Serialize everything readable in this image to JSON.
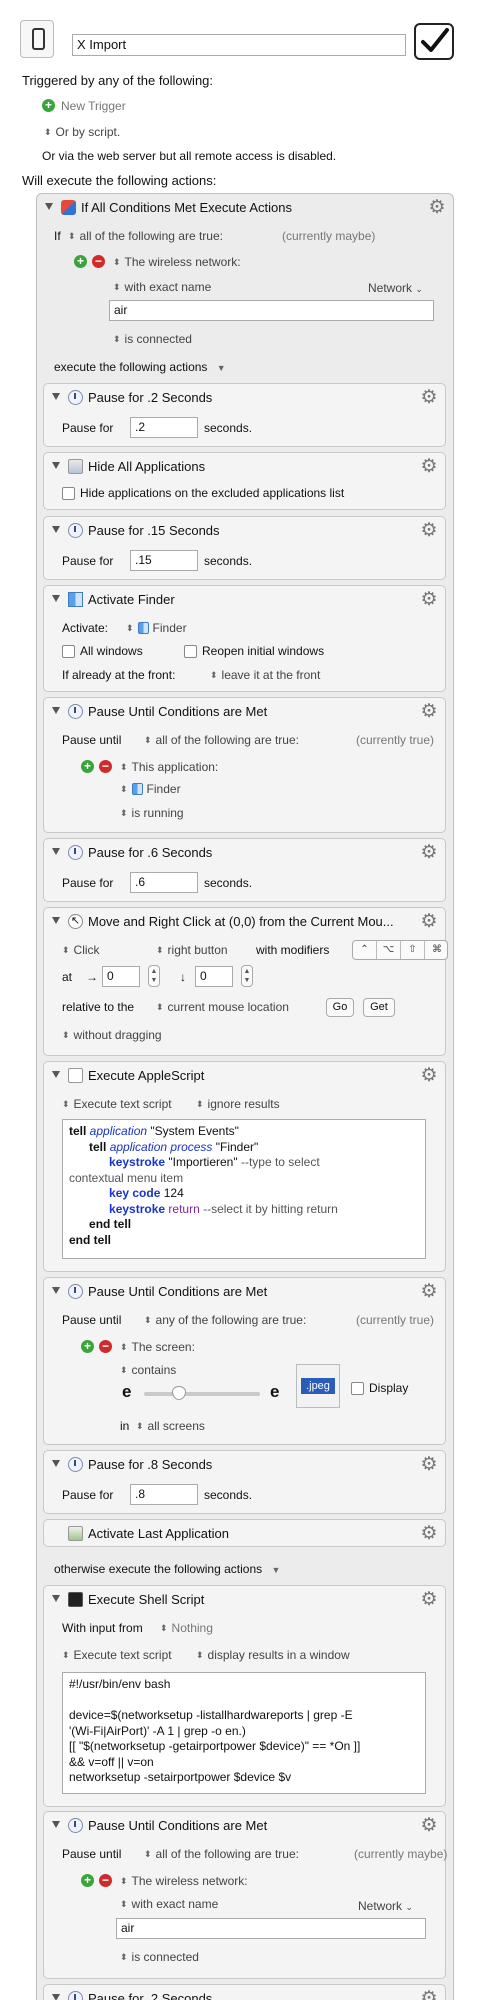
{
  "macro": {
    "name": "X Import",
    "enabled": true
  },
  "triggers": {
    "heading": "Triggered by any of the following:",
    "new_trigger": "New Trigger",
    "or_by_script": "Or by script.",
    "web_note": "Or via the web server but all remote access is disabled."
  },
  "will_execute": "Will execute the following actions:",
  "if_action": {
    "title": "If All Conditions Met Execute Actions",
    "if_label": "If",
    "condition_mode": "all of the following are true:",
    "status": "(currently maybe)",
    "wireless": {
      "label": "The wireless network:",
      "match": "with exact name",
      "network_menu": "Network",
      "value": "air",
      "state": "is connected"
    },
    "then_label": "execute the following actions",
    "otherwise_label": "otherwise execute the following actions"
  },
  "pause1": {
    "title": "Pause for .2 Seconds",
    "label": "Pause for",
    "value": ".2",
    "unit": "seconds."
  },
  "hide_all": {
    "title": "Hide All Applications",
    "option": "Hide applications on the excluded applications list"
  },
  "pause2": {
    "title": "Pause for .15 Seconds",
    "label": "Pause for",
    "value": ".15",
    "unit": "seconds."
  },
  "activate_finder": {
    "title": "Activate Finder",
    "activate_label": "Activate:",
    "app": "Finder",
    "all_windows": "All windows",
    "reopen": "Reopen initial windows",
    "front_label": "If already at the front:",
    "front_value": "leave it at the front"
  },
  "pause_until1": {
    "title": "Pause Until Conditions are Met",
    "label": "Pause until",
    "mode": "all of the following are true:",
    "status": "(currently true)",
    "cond_label": "This application:",
    "app": "Finder",
    "state": "is running"
  },
  "pause3": {
    "title": "Pause for .6 Seconds",
    "label": "Pause for",
    "value": ".6",
    "unit": "seconds."
  },
  "move_click": {
    "title": "Move and Right Click at (0,0) from the Current Mou...",
    "click": "Click",
    "button": "right button",
    "modifiers_label": "with modifiers",
    "modifier_keys": [
      "⌃",
      "⌥",
      "⇧",
      "⌘"
    ],
    "at_label": "at",
    "x_arrow": "→",
    "x": "0",
    "y_arrow": "↓",
    "y": "0",
    "relative_label": "relative to the",
    "relative_value": "current mouse location",
    "go_button": "Go",
    "get_button": "Get",
    "drag": "without dragging"
  },
  "applescript": {
    "title": "Execute AppleScript",
    "mode": "Execute text script",
    "results": "ignore results",
    "lines": [
      [
        [
          "kw",
          "tell "
        ],
        [
          "it",
          "application"
        ],
        [
          "",
          " \"System Events\""
        ]
      ],
      [
        [
          "",
          "      "
        ],
        [
          "kw",
          "tell "
        ],
        [
          "it",
          "application process"
        ],
        [
          "",
          " \"Finder\""
        ]
      ],
      [
        [
          "",
          "            "
        ],
        [
          "bl",
          "keystroke"
        ],
        [
          "",
          " \"Importieren\" "
        ],
        [
          "cmt",
          "--type to select"
        ]
      ],
      [
        [
          "cmt",
          "contextual menu item"
        ]
      ],
      [
        [
          "",
          "            "
        ],
        [
          "bl",
          "key code"
        ],
        [
          "",
          " 124"
        ]
      ],
      [
        [
          "",
          "            "
        ],
        [
          "bl",
          "keystroke"
        ],
        [
          "pur",
          " return"
        ],
        [
          "cmt",
          " --select it by hitting return"
        ]
      ],
      [
        [
          "",
          "      "
        ],
        [
          "kw",
          "end tell"
        ]
      ],
      [
        [
          "kw",
          "end tell"
        ]
      ]
    ]
  },
  "pause_until2": {
    "title": "Pause Until Conditions are Met",
    "label": "Pause until",
    "mode": "any of the following are true:",
    "status": "(currently true)",
    "cond_label": "The screen:",
    "match": "contains",
    "slider_left": "e",
    "slider_right": "e",
    "slider_value": 0.3,
    "image_text": ".jpeg",
    "display_label": "Display",
    "in_label": "in",
    "in_value": "all screens"
  },
  "pause4": {
    "title": "Pause for .8 Seconds",
    "label": "Pause for",
    "value": ".8",
    "unit": "seconds."
  },
  "activate_last": {
    "title": "Activate Last Application"
  },
  "shell": {
    "title": "Execute Shell Script",
    "input_label": "With input from",
    "input_value": "Nothing",
    "mode": "Execute text script",
    "output": "display results in a window",
    "code": "#!/usr/bin/env bash\n\ndevice=$(networksetup -listallhardwareports | grep -E\n'(Wi-Fi|AirPort)' -A 1 | grep -o en.)\n[[ \"$(networksetup -getairportpower $device)\" == *On ]]\n&& v=off || v=on\nnetworksetup -setairportpower $device $v"
  },
  "pause_until3": {
    "title": "Pause Until Conditions are Met",
    "label": "Pause until",
    "mode": "all of the following are true:",
    "status": "(currently maybe)",
    "cond_label": "The wireless network:",
    "match": "with exact name",
    "network_menu": "Network",
    "value": "air",
    "state": "is connected"
  },
  "pause5": {
    "title": "Pause for .2 Seconds"
  }
}
